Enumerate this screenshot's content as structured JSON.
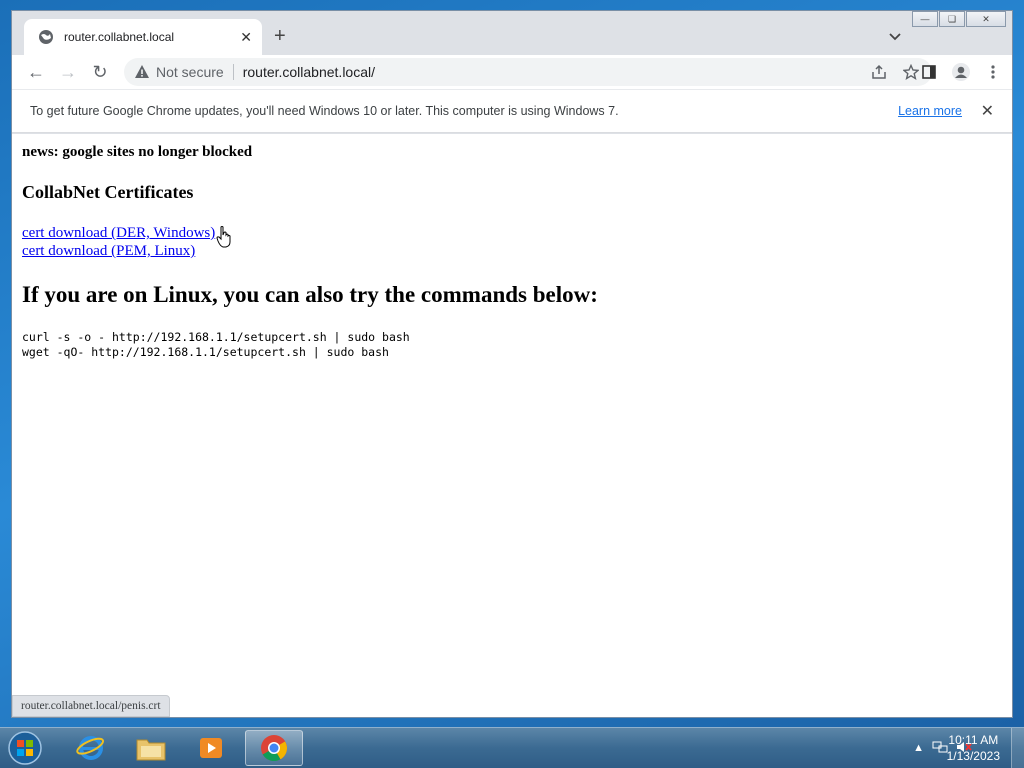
{
  "browser": {
    "tab": {
      "title": "router.collabnet.local"
    },
    "address": {
      "security_label": "Not secure",
      "url": "router.collabnet.local/"
    },
    "infobar": {
      "message": "To get future Google Chrome updates, you'll need Windows 10 or later. This computer is using Windows 7.",
      "learn_more": "Learn more"
    },
    "status_url": "router.collabnet.local/penis.crt"
  },
  "page": {
    "news": "news: google sites no longer blocked",
    "certs_heading": "CollabNet Certificates",
    "links": [
      {
        "label": "cert download (DER, Windows)"
      },
      {
        "label": "cert download (PEM, Linux)"
      }
    ],
    "linux_heading": "If you are on Linux, you can also try the commands below:",
    "commands": [
      "curl -s -o - http://192.168.1.1/setupcert.sh | sudo bash",
      "wget -qO- http://192.168.1.1/setupcert.sh | sudo bash"
    ]
  },
  "taskbar": {
    "apps": [
      "internet-explorer",
      "windows-explorer",
      "media-player",
      "google-chrome"
    ],
    "active_app": "google-chrome",
    "time": "10:11 AM",
    "date": "1/13/2023"
  }
}
